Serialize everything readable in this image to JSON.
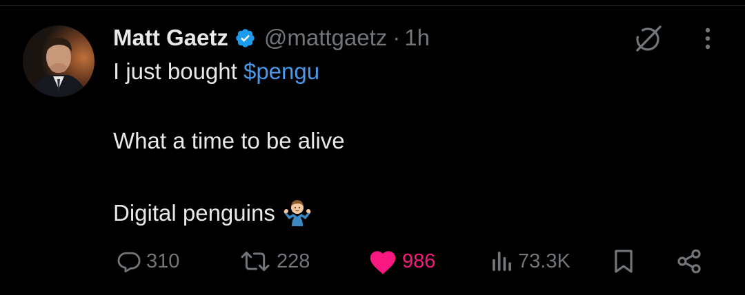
{
  "tweet": {
    "author": {
      "name": "Matt Gaetz",
      "handle": "@mattgaetz",
      "verified": true,
      "avatar_icon": "profile-photo"
    },
    "separator": "·",
    "time": "1h",
    "text": {
      "line1_prefix": "I just bought ",
      "cashtag": "$pengu",
      "line2": "What a time to be alive",
      "line3": "Digital penguins",
      "line3_emoji": "person-shrugging-emoji"
    },
    "header_icons": [
      "grok-icon",
      "more-icon"
    ],
    "stats": {
      "replies": "310",
      "reposts": "228",
      "likes": "986",
      "views": "73.3K"
    },
    "action_icons": [
      "reply-icon",
      "repost-icon",
      "like-icon",
      "views-icon",
      "bookmark-icon",
      "share-icon"
    ]
  },
  "colors": {
    "background": "#000000",
    "text_primary": "#e7e9ea",
    "text_secondary": "#71767b",
    "link": "#4a99e9",
    "verified_badge": "#1d9bf0",
    "like_active": "#f91880"
  }
}
